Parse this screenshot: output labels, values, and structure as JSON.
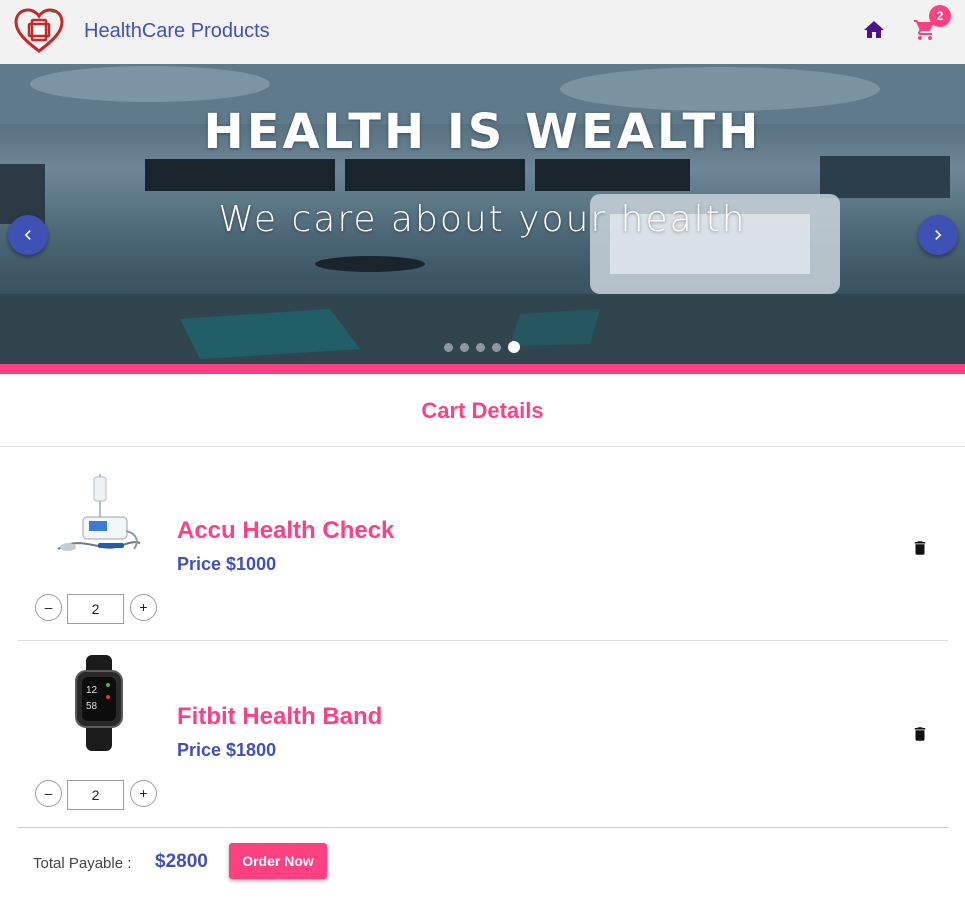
{
  "header": {
    "brand": "HealthCare Products",
    "cart_count": "2",
    "icons": {
      "logo": "heart-cross-logo",
      "home": "home-icon",
      "cart": "cart-icon"
    },
    "colors": {
      "brand": "#3f51b5",
      "accent": "#ff4081",
      "home_icon": "#4a148c"
    }
  },
  "hero": {
    "title": "HEALTH IS WEALTH",
    "subtitle": "We care about your health",
    "slides_total": 5,
    "active_slide": 5
  },
  "cart": {
    "title": "Cart Details",
    "items": [
      {
        "name": "Accu Health Check",
        "price": "Price $1000",
        "quantity": "2",
        "image_icon": "medical-device-image"
      },
      {
        "name": "Fitbit Health Band",
        "price": "Price $1800",
        "quantity": "2",
        "image_icon": "smartwatch-image"
      }
    ],
    "total_label": "Total Payable :",
    "total_value": "$2800",
    "order_button": "Order Now"
  }
}
